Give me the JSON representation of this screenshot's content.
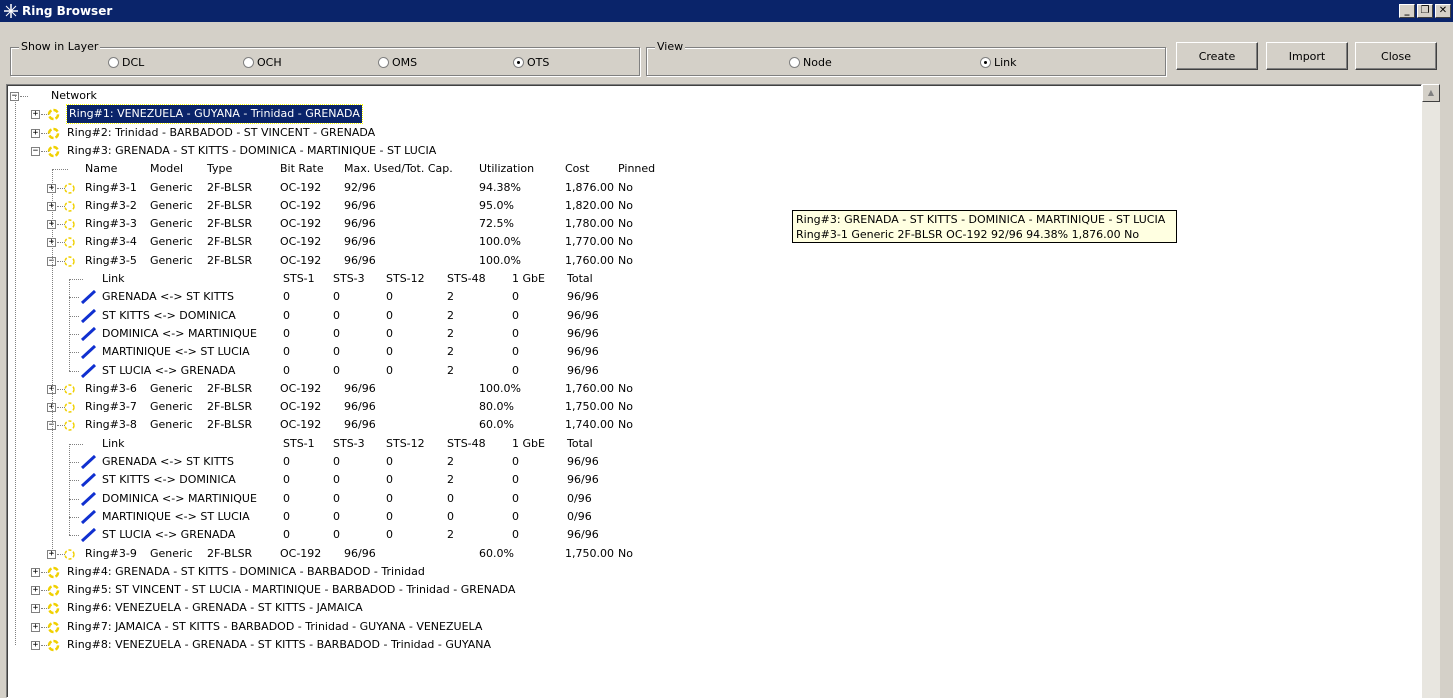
{
  "window": {
    "title": "Ring Browser",
    "controls": [
      "_",
      "̅□",
      "✕"
    ]
  },
  "layer_group": {
    "legend": "Show in Layer",
    "options": [
      "DCL",
      "OCH",
      "OMS",
      "OTS"
    ],
    "selected": "OTS"
  },
  "view_group": {
    "legend": "View",
    "options": [
      "Node",
      "Link"
    ],
    "selected": "Link"
  },
  "buttons": {
    "create": "Create",
    "import": "Import",
    "close": "Close"
  },
  "tree": {
    "root": "Network",
    "rings": [
      "Ring#1: VENEZUELA - GUYANA - Trinidad - GRENADA",
      "Ring#2: Trinidad - BARBADOD - ST VINCENT - GRENADA",
      "Ring#3: GRENADA - ST KITTS - DOMINICA - MARTINIQUE - ST LUCIA",
      "Ring#4: GRENADA - ST KITTS - DOMINICA - BARBADOD - Trinidad",
      "Ring#5: ST VINCENT - ST LUCIA - MARTINIQUE - BARBADOD - Trinidad - GRENADA",
      "Ring#6: VENEZUELA - GRENADA - ST KITTS - JAMAICA",
      "Ring#7: JAMAICA - ST KITTS - BARBADOD - Trinidad - GUYANA - VENEZUELA",
      "Ring#8: VENEZUELA - GRENADA - ST KITTS - BARBADOD - Trinidad - GUYANA"
    ],
    "subring_headers": [
      "Name",
      "Model",
      "Type",
      "Bit Rate",
      "Max. Used/Tot. Cap.",
      "Utilization",
      "Cost",
      "Pinned"
    ],
    "subrings": [
      [
        "Ring#3-1",
        "Generic",
        "2F-BLSR",
        "OC-192",
        "92/96",
        "94.38%",
        "1,876.00",
        "No"
      ],
      [
        "Ring#3-2",
        "Generic",
        "2F-BLSR",
        "OC-192",
        "96/96",
        "95.0%",
        "1,820.00",
        "No"
      ],
      [
        "Ring#3-3",
        "Generic",
        "2F-BLSR",
        "OC-192",
        "96/96",
        "72.5%",
        "1,780.00",
        "No"
      ],
      [
        "Ring#3-4",
        "Generic",
        "2F-BLSR",
        "OC-192",
        "96/96",
        "100.0%",
        "1,770.00",
        "No"
      ],
      [
        "Ring#3-5",
        "Generic",
        "2F-BLSR",
        "OC-192",
        "96/96",
        "100.0%",
        "1,760.00",
        "No"
      ],
      [
        "Ring#3-6",
        "Generic",
        "2F-BLSR",
        "OC-192",
        "96/96",
        "100.0%",
        "1,760.00",
        "No"
      ],
      [
        "Ring#3-7",
        "Generic",
        "2F-BLSR",
        "OC-192",
        "96/96",
        "80.0%",
        "1,750.00",
        "No"
      ],
      [
        "Ring#3-8",
        "Generic",
        "2F-BLSR",
        "OC-192",
        "96/96",
        "60.0%",
        "1,740.00",
        "No"
      ],
      [
        "Ring#3-9",
        "Generic",
        "2F-BLSR",
        "OC-192",
        "96/96",
        "60.0%",
        "1,750.00",
        "No"
      ]
    ],
    "link_headers": [
      "Link",
      "STS-1",
      "STS-3",
      "STS-12",
      "STS-48",
      "1 GbE",
      "Total"
    ],
    "links_ring3_5": [
      [
        "GRENADA <-> ST KITTS",
        "0",
        "0",
        "0",
        "2",
        "0",
        "96/96"
      ],
      [
        "ST KITTS <-> DOMINICA",
        "0",
        "0",
        "0",
        "2",
        "0",
        "96/96"
      ],
      [
        "DOMINICA <-> MARTINIQUE",
        "0",
        "0",
        "0",
        "2",
        "0",
        "96/96"
      ],
      [
        "MARTINIQUE <-> ST LUCIA",
        "0",
        "0",
        "0",
        "2",
        "0",
        "96/96"
      ],
      [
        "ST LUCIA <-> GRENADA",
        "0",
        "0",
        "0",
        "2",
        "0",
        "96/96"
      ]
    ],
    "links_ring3_8": [
      [
        "GRENADA <-> ST KITTS",
        "0",
        "0",
        "0",
        "2",
        "0",
        "96/96"
      ],
      [
        "ST KITTS <-> DOMINICA",
        "0",
        "0",
        "0",
        "2",
        "0",
        "96/96"
      ],
      [
        "DOMINICA <-> MARTINIQUE",
        "0",
        "0",
        "0",
        "0",
        "0",
        "0/96"
      ],
      [
        "MARTINIQUE <-> ST LUCIA",
        "0",
        "0",
        "0",
        "0",
        "0",
        "0/96"
      ],
      [
        "ST LUCIA <-> GRENADA",
        "0",
        "0",
        "0",
        "2",
        "0",
        "96/96"
      ]
    ]
  },
  "tooltip": {
    "line1": "Ring#3: GRENADA - ST KITTS - DOMINICA - MARTINIQUE - ST LUCIA",
    "line2": "Ring#3-1 Generic 2F-BLSR OC-192 92/96 94.38% 1,876.00 No"
  },
  "colors": {
    "titlebar": "#0a246a",
    "selection": "#0a246a",
    "ring_icon": "#f0d000",
    "link_icon": "#1030d0",
    "tooltip_bg": "#ffffe1"
  }
}
